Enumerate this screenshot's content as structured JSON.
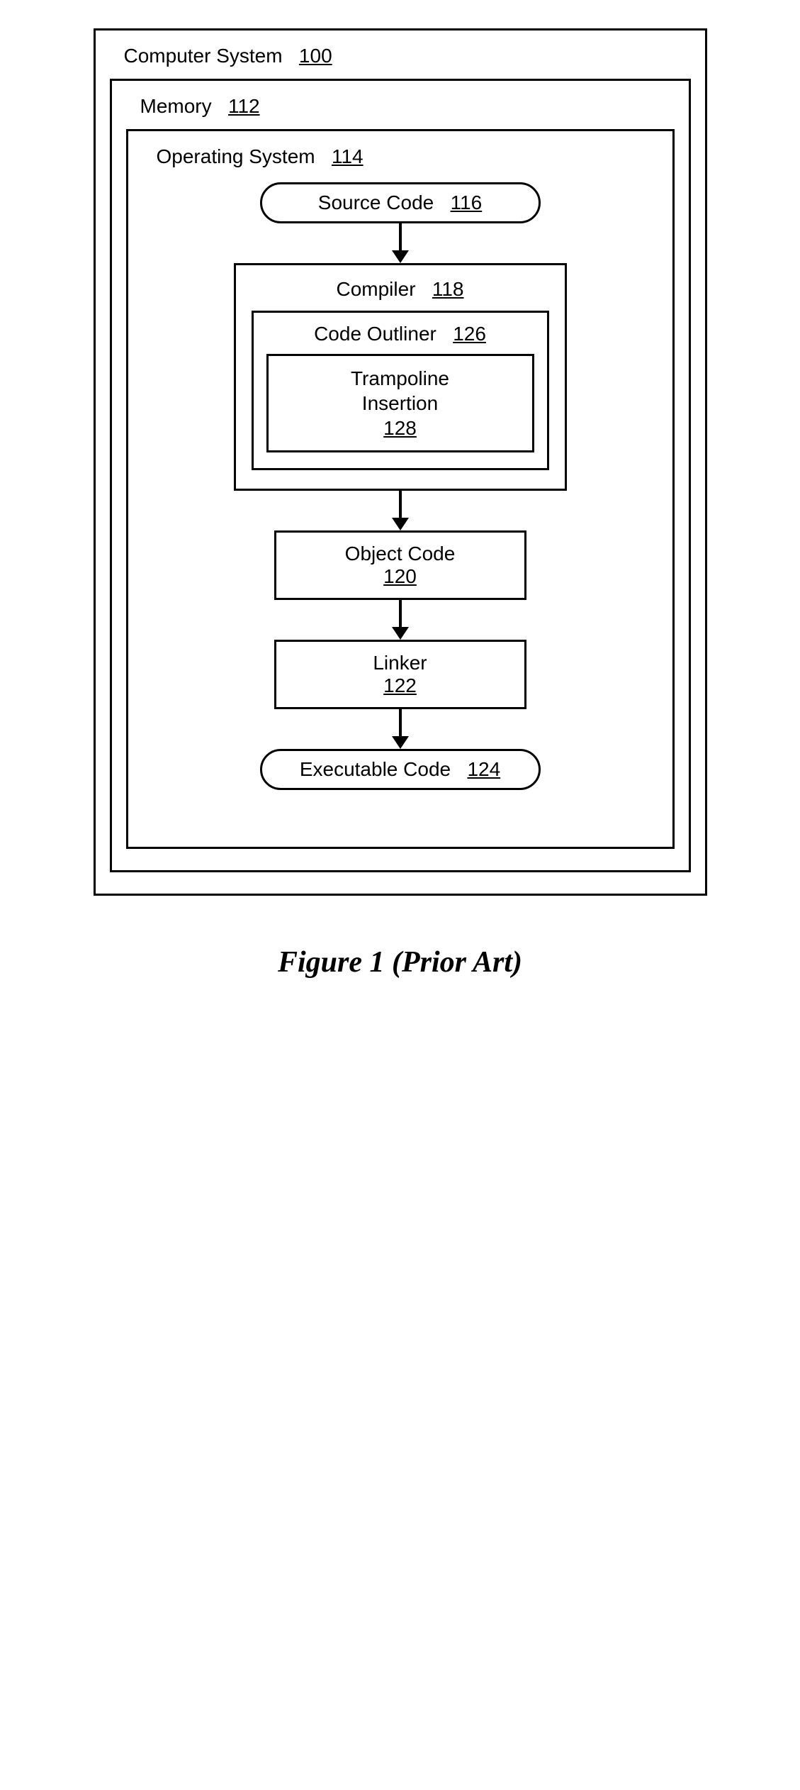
{
  "computer": {
    "label": "Computer System",
    "ref": "100"
  },
  "memory": {
    "label": "Memory",
    "ref": "112"
  },
  "os": {
    "label": "Operating System",
    "ref": "114"
  },
  "source": {
    "label": "Source Code",
    "ref": "116"
  },
  "compiler": {
    "label": "Compiler",
    "ref": "118"
  },
  "outliner": {
    "label": "Code Outliner",
    "ref": "126"
  },
  "tramp": {
    "line1": "Trampoline",
    "line2": "Insertion",
    "ref": "128"
  },
  "object": {
    "label": "Object Code",
    "ref": "120"
  },
  "linker": {
    "label": "Linker",
    "ref": "122"
  },
  "exec": {
    "label": "Executable Code",
    "ref": "124"
  },
  "caption": "Figure 1 (Prior Art)"
}
